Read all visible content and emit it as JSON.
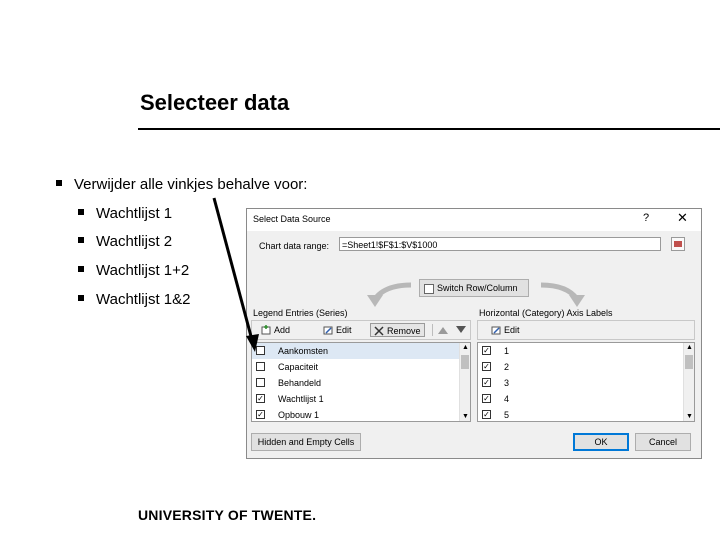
{
  "slide": {
    "title": "Selecteer data",
    "bullets": [
      "Verwijder alle vinkjes behalve voor:",
      "Wachtlijst 1",
      "Wachtlijst 2",
      "Wachtlijst 1+2",
      "Wachtlijst 1&2"
    ],
    "logo": "UNIVERSITY OF TWENTE."
  },
  "dialog": {
    "title": "Select Data Source",
    "help": "?",
    "close": "✕",
    "range_label": "Chart data range:",
    "range_value": "=Sheet1!$F$1:$V$1000",
    "switch_label": "Switch Row/Column",
    "legend_label": "Legend Entries (Series)",
    "axis_label": "Horizontal (Category) Axis Labels",
    "add_label": "Add",
    "edit_label": "Edit",
    "remove_label": "Remove",
    "axis_edit_label": "Edit",
    "series": [
      {
        "label": "Aankomsten",
        "checked": false
      },
      {
        "label": "Capaciteit",
        "checked": false
      },
      {
        "label": "Behandeld",
        "checked": false
      },
      {
        "label": "Wachtlijst 1",
        "checked": true
      },
      {
        "label": "Opbouw 1",
        "checked": true
      }
    ],
    "categories": [
      {
        "label": "1",
        "checked": true
      },
      {
        "label": "2",
        "checked": true
      },
      {
        "label": "3",
        "checked": true
      },
      {
        "label": "4",
        "checked": true
      },
      {
        "label": "5",
        "checked": true
      }
    ],
    "hidden_cells_label": "Hidden and Empty Cells",
    "ok_label": "OK",
    "cancel_label": "Cancel"
  }
}
